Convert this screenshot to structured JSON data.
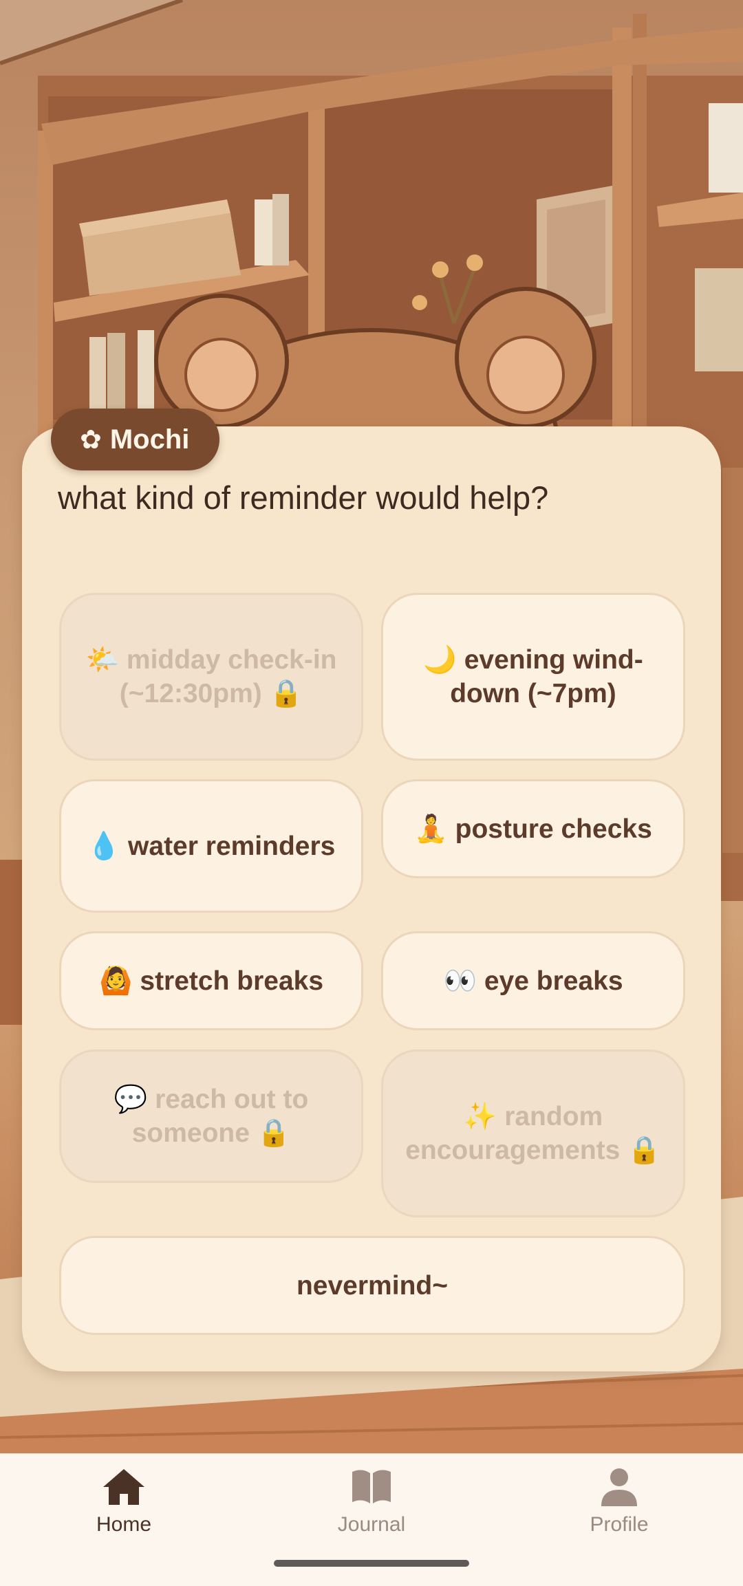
{
  "companion": {
    "flower": "✿",
    "name": "Mochi"
  },
  "prompt": "what kind of reminder would help?",
  "options": [
    {
      "emoji": "🌤️",
      "label": "midday check-in (~12:30pm)",
      "lock": "🔒",
      "locked": true
    },
    {
      "emoji": "🌙",
      "label": "evening wind-down (~7pm)",
      "locked": false
    },
    {
      "emoji": "💧",
      "label": "water reminders",
      "locked": false
    },
    {
      "emoji": "🧘",
      "label": "posture checks",
      "locked": false
    },
    {
      "emoji": "🙆",
      "label": "stretch breaks",
      "locked": false
    },
    {
      "emoji": "👀",
      "label": "eye breaks",
      "locked": false
    },
    {
      "emoji": "💬",
      "label": "reach out to someone",
      "lock": "🔒",
      "locked": true
    },
    {
      "emoji": "✨",
      "label": "random encouragements",
      "lock": "🔒",
      "locked": true
    }
  ],
  "dismiss_label": "nevermind~",
  "nav": {
    "items": [
      {
        "label": "Home",
        "icon": "home-icon",
        "active": true
      },
      {
        "label": "Journal",
        "icon": "book-icon",
        "active": false
      },
      {
        "label": "Profile",
        "icon": "person-icon",
        "active": false
      }
    ]
  },
  "colors": {
    "card_bg": "#f7e6cb",
    "tag_bg": "#7a4a2f",
    "option_bg": "#fdf1e2",
    "option_locked_bg": "#f1e1cd",
    "text_dark": "#5c3b2b"
  }
}
